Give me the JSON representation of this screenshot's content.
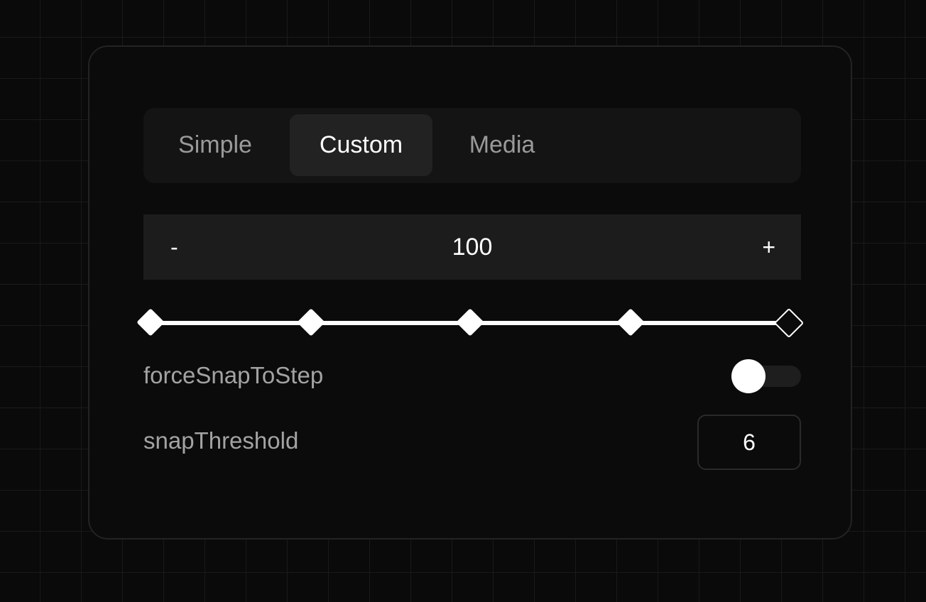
{
  "tabs": [
    {
      "label": "Simple",
      "active": false
    },
    {
      "label": "Custom",
      "active": true
    },
    {
      "label": "Media",
      "active": false
    }
  ],
  "stepper": {
    "minus_label": "-",
    "value": "100",
    "plus_label": "+"
  },
  "slider": {
    "steps": 5,
    "current_step": 5,
    "fraction": 1.0
  },
  "options": {
    "force_snap_label": "forceSnapToStep",
    "force_snap_on": false,
    "snap_threshold_label": "snapThreshold",
    "snap_threshold_value": "6"
  },
  "colors": {
    "background": "#0a0a0a",
    "accent": "#ffffff",
    "muted_text": "#a3a3a3"
  },
  "icons": {
    "slider_tick": "diamond-shape",
    "slider_thumb": "hollow-diamond-shape"
  }
}
